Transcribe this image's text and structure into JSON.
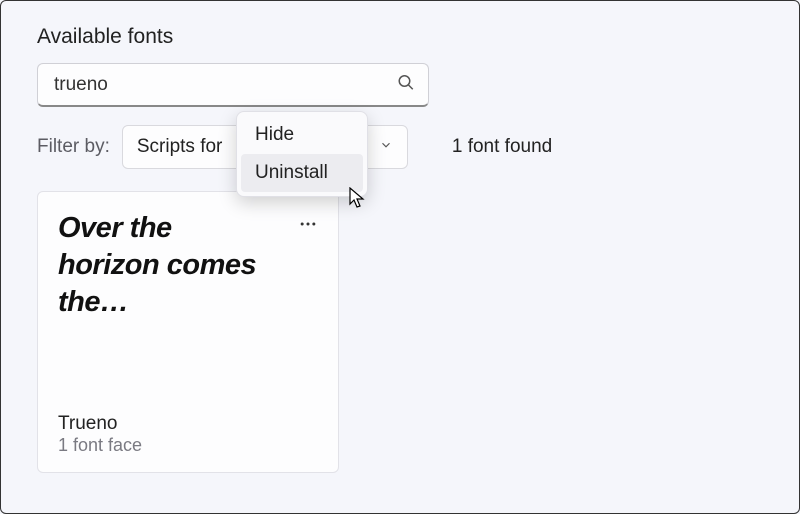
{
  "section_title": "Available fonts",
  "search": {
    "value": "trueno"
  },
  "filter": {
    "label": "Filter by:",
    "selected": "Scripts for"
  },
  "results_label": "1 font found",
  "context_menu": {
    "items": [
      {
        "label": "Hide"
      },
      {
        "label": "Uninstall"
      }
    ]
  },
  "card": {
    "sample": "Over the horizon comes the…",
    "name": "Trueno",
    "faces": "1 font face"
  }
}
